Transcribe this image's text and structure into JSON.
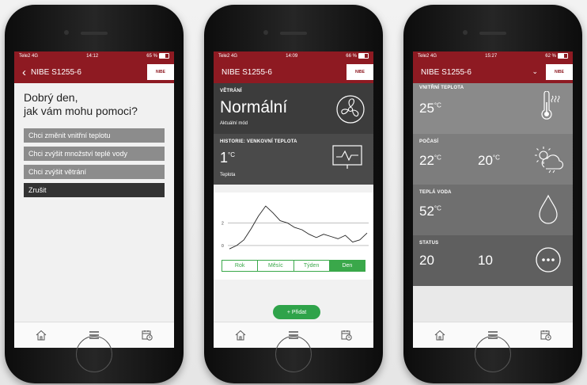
{
  "phone1": {
    "status": {
      "carrier": "Tele2",
      "network": "4G",
      "time": "14:12",
      "battery": "65 %"
    },
    "nav": {
      "title": "NIBE S1255-6",
      "logo": "NIBE"
    },
    "greeting_line1": "Dobrý den,",
    "greeting_line2": "jak vám mohu pomoci?",
    "options": [
      "Chci změnit vnitřní teplotu",
      "Chci zvýšit množství teplé vody",
      "Chci zvýšit větrání",
      "Zrušit"
    ]
  },
  "phone2": {
    "status": {
      "carrier": "Tele2",
      "network": "4G",
      "time": "14:09",
      "battery": "66 %"
    },
    "nav": {
      "title": "NIBE S1255-6",
      "logo": "NIBE"
    },
    "ventilation": {
      "label": "VĚTRÁNÍ",
      "value": "Normální",
      "sub": "Aktuální mód"
    },
    "history": {
      "label": "HISTORIE: VENKOVNÍ TEPLOTA",
      "value": "1",
      "unit": "°C",
      "sub": "Teplota"
    },
    "periods": [
      "Rok",
      "Měsíc",
      "Týden",
      "Den"
    ],
    "add_label": "+ Přidat",
    "chart_data": {
      "type": "line",
      "y_ticks": [
        "2",
        "0"
      ],
      "ylim": [
        -0.5,
        4
      ],
      "values": [
        -0.3,
        0.0,
        0.5,
        1.5,
        2.6,
        3.5,
        2.9,
        2.2,
        2.0,
        1.6,
        1.4,
        1.0,
        0.7,
        1.0,
        0.8,
        0.6,
        0.9,
        0.3,
        0.5,
        1.1
      ],
      "selected_period": "Den"
    }
  },
  "phone3": {
    "status": {
      "carrier": "Tele2",
      "network": "4G",
      "time": "15:27",
      "battery": "62 %"
    },
    "nav": {
      "title": "NIBE S1255-6",
      "logo": "NIBE"
    },
    "indoor": {
      "label": "VNITŘNÍ TEPLOTA",
      "value": "25",
      "unit": "°C"
    },
    "weather": {
      "label": "POČASÍ",
      "value1": "22",
      "value2": "20",
      "unit": "°C"
    },
    "hotwater": {
      "label": "TEPLÁ VODA",
      "value": "52",
      "unit": "°C"
    },
    "status_row": {
      "label": "STATUS",
      "value1": "20",
      "value2": "10"
    }
  },
  "icons": [
    "home-icon",
    "menu-icon",
    "calendar-clock-icon",
    "fan-icon",
    "chart-monitor-icon",
    "thermometer-icon",
    "sun-cloud-icon",
    "water-drop-icon",
    "more-icon",
    "back-chevron-icon",
    "chevron-down-icon"
  ],
  "colors": {
    "brand": "#8e1a22",
    "accent_green": "#3aa84a"
  }
}
